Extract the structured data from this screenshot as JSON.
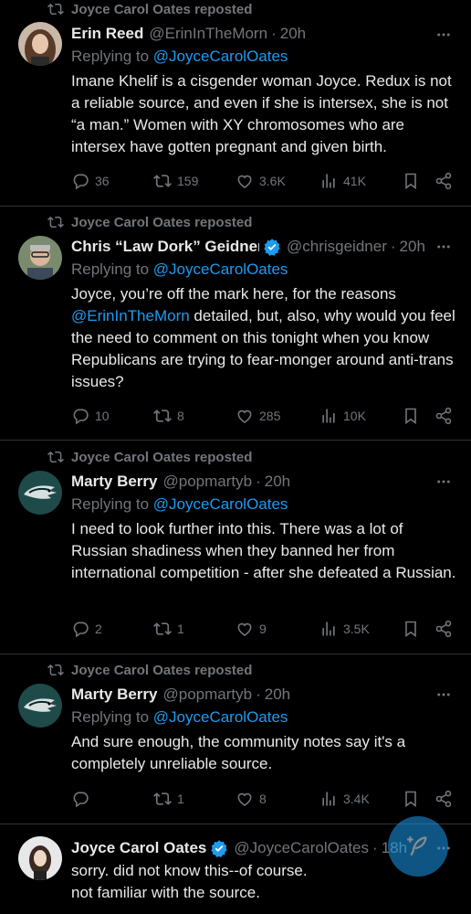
{
  "tweets": [
    {
      "repost": "Joyce Carol Oates reposted",
      "name": "Erin Reed",
      "handle": "@ErinInTheMorn",
      "time": "20h",
      "reply_label": "Replying to ",
      "reply_to": "@JoyceCarolOates",
      "text": "Imane Khelif is a cisgender woman Joyce. Redux is not a reliable source, and even if she is intersex, she is not “a man.” Women with XY chromosomes who are intersex have gotten pregnant and given birth.",
      "replies": "36",
      "reposts": "159",
      "likes": "3.6K",
      "views": "41K"
    },
    {
      "repost": "Joyce Carol Oates reposted",
      "name": "Chris “Law Dork” Geidner",
      "handle": "@chrisgeidner",
      "time": "20h",
      "reply_label": "Replying to ",
      "reply_to": "@JoyceCarolOates",
      "text_before": "Joyce, you’re off the mark here, for the reasons ",
      "text_mention": "@ErinInTheMorn",
      "text_after": " detailed, but, also, why would you feel the need to comment on this tonight when you know Republicans are trying to fear-monger around anti-trans issues?",
      "replies": "10",
      "reposts": "8",
      "likes": "285",
      "views": "10K"
    },
    {
      "repost": "Joyce Carol Oates reposted",
      "name": "Marty Berry",
      "handle": "@popmartyb",
      "time": "20h",
      "reply_label": "Replying to ",
      "reply_to": "@JoyceCarolOates",
      "text": "I need to look further into this. There was a lot of Russian shadiness when they banned her from international competition - after she defeated a Russian.",
      "replies": "2",
      "reposts": "1",
      "likes": "9",
      "views": "3.5K"
    },
    {
      "repost": "Joyce Carol Oates reposted",
      "name": "Marty Berry",
      "handle": "@popmartyb",
      "time": "20h",
      "reply_label": "Replying to ",
      "reply_to": "@JoyceCarolOates",
      "text": "And sure enough, the community notes say it's a completely unreliable source.",
      "replies": "",
      "reposts": "1",
      "likes": "8",
      "views": "3.4K"
    },
    {
      "name": "Joyce Carol Oates",
      "handle": "@JoyceCarolOates",
      "time": "18h",
      "text": "sorry. did not know this--of course.\nnot familiar with the source."
    }
  ],
  "colors": {
    "accent": "#1d9bf0",
    "muted": "#71767b",
    "text": "#e7e9ea",
    "background": "#000000"
  }
}
